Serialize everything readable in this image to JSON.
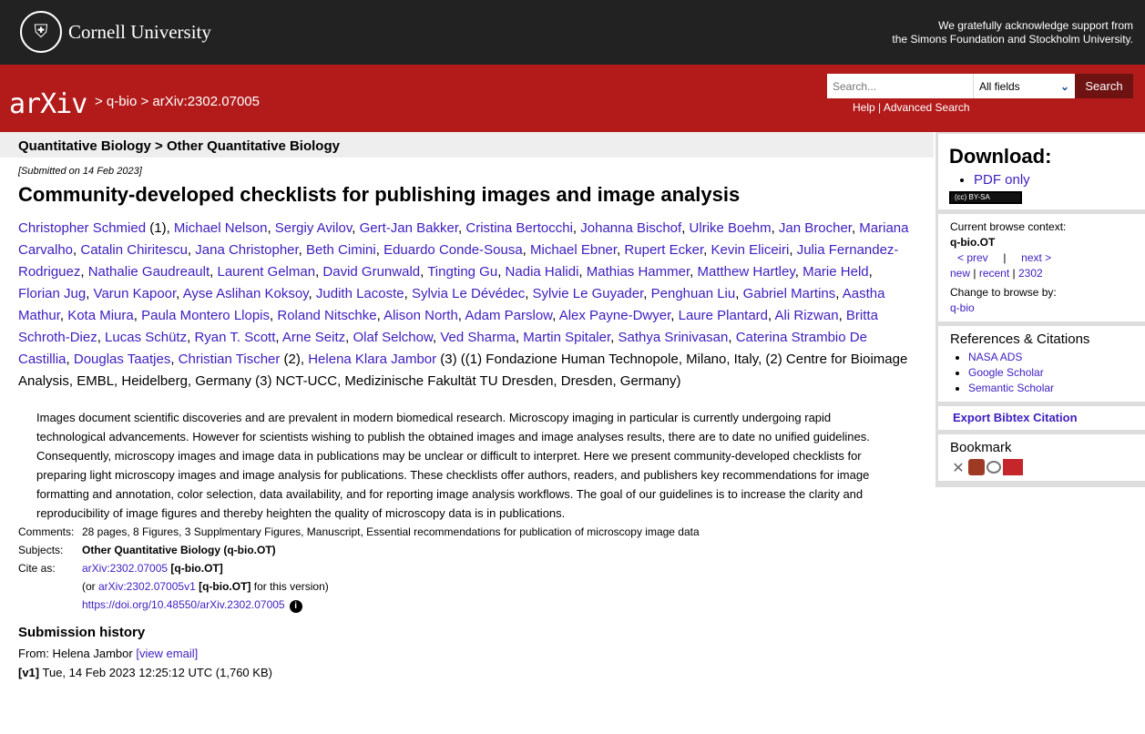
{
  "header": {
    "university": "Cornell University",
    "ack_line1": "We gratefully acknowledge support from",
    "ack_line2": "the Simons Foundation and Stockholm University."
  },
  "nav": {
    "logo": "arXiv",
    "breadcrumb": "> q-bio > arXiv:2302.07005",
    "search_placeholder": "Search...",
    "field_select": "All fields",
    "search_button": "Search",
    "help": "Help",
    "sep": "|",
    "advanced": "Advanced Search"
  },
  "paper": {
    "category": "Quantitative Biology > Other Quantitative Biology",
    "submitted": "[Submitted on 14 Feb 2023]",
    "title": "Community-developed checklists for publishing images and image analysis",
    "authors": [
      {
        "name": "Christopher Schmied",
        "after": " (1), "
      },
      {
        "name": "Michael Nelson",
        "after": ", "
      },
      {
        "name": "Sergiy Avilov",
        "after": ", "
      },
      {
        "name": "Gert-Jan Bakker",
        "after": ", "
      },
      {
        "name": "Cristina Bertocchi",
        "after": ", "
      },
      {
        "name": "Johanna Bischof",
        "after": ", "
      },
      {
        "name": "Ulrike Boehm",
        "after": ", "
      },
      {
        "name": "Jan Brocher",
        "after": ", "
      },
      {
        "name": "Mariana Carvalho",
        "after": ", "
      },
      {
        "name": "Catalin Chiritescu",
        "after": ", "
      },
      {
        "name": "Jana Christopher",
        "after": ", "
      },
      {
        "name": "Beth Cimini",
        "after": ", "
      },
      {
        "name": "Eduardo Conde-Sousa",
        "after": ", "
      },
      {
        "name": "Michael Ebner",
        "after": ", "
      },
      {
        "name": "Rupert Ecker",
        "after": ", "
      },
      {
        "name": "Kevin Eliceiri",
        "after": ", "
      },
      {
        "name": "Julia Fernandez-Rodriguez",
        "after": ", "
      },
      {
        "name": "Nathalie Gaudreault",
        "after": ", "
      },
      {
        "name": "Laurent Gelman",
        "after": ", "
      },
      {
        "name": "David Grunwald",
        "after": ", "
      },
      {
        "name": "Tingting Gu",
        "after": ", "
      },
      {
        "name": "Nadia Halidi",
        "after": ", "
      },
      {
        "name": "Mathias Hammer",
        "after": ", "
      },
      {
        "name": "Matthew Hartley",
        "after": ", "
      },
      {
        "name": "Marie Held",
        "after": ", "
      },
      {
        "name": "Florian Jug",
        "after": ", "
      },
      {
        "name": "Varun Kapoor",
        "after": ", "
      },
      {
        "name": "Ayse Aslihan Koksoy",
        "after": ", "
      },
      {
        "name": "Judith Lacoste",
        "after": ", "
      },
      {
        "name": "Sylvia Le Dévédec",
        "after": ", "
      },
      {
        "name": "Sylvie Le Guyader",
        "after": ", "
      },
      {
        "name": "Penghuan Liu",
        "after": ", "
      },
      {
        "name": "Gabriel Martins",
        "after": ", "
      },
      {
        "name": "Aastha Mathur",
        "after": ", "
      },
      {
        "name": "Kota Miura",
        "after": ", "
      },
      {
        "name": "Paula Montero Llopis",
        "after": ", "
      },
      {
        "name": "Roland Nitschke",
        "after": ", "
      },
      {
        "name": "Alison North",
        "after": ", "
      },
      {
        "name": "Adam Parslow",
        "after": ", "
      },
      {
        "name": "Alex Payne-Dwyer",
        "after": ", "
      },
      {
        "name": "Laure Plantard",
        "after": ", "
      },
      {
        "name": "Ali Rizwan",
        "after": ", "
      },
      {
        "name": "Britta Schroth-Diez",
        "after": ", "
      },
      {
        "name": "Lucas Schütz",
        "after": ", "
      },
      {
        "name": "Ryan T. Scott",
        "after": ", "
      },
      {
        "name": "Arne Seitz",
        "after": ", "
      },
      {
        "name": "Olaf Selchow",
        "after": ", "
      },
      {
        "name": "Ved Sharma",
        "after": ", "
      },
      {
        "name": "Martin Spitaler",
        "after": ", "
      },
      {
        "name": "Sathya Srinivasan",
        "after": ", "
      },
      {
        "name": "Caterina Strambio De Castillia",
        "after": ", "
      },
      {
        "name": "Douglas Taatjes",
        "after": ", "
      },
      {
        "name": "Christian Tischer",
        "after": " (2), "
      },
      {
        "name": "Helena Klara Jambor",
        "after": " (3) ((1) Fondazione Human Technopole, Milano, Italy, (2) Centre for Bioimage Analysis, EMBL, Heidelberg, Germany (3) NCT-UCC, Medizinische Fakultät TU Dresden, Dresden, Germany)"
      }
    ],
    "abstract": "Images document scientific discoveries and are prevalent in modern biomedical research. Microscopy imaging in particular is currently undergoing rapid technological advancements. However for scientists wishing to publish the obtained images and image analyses results, there are to date no unified guidelines. Consequently, microscopy images and image data in publications may be unclear or difficult to interpret. Here we present community-developed checklists for preparing light microscopy images and image analysis for publications. These checklists offer authors, readers, and publishers key recommendations for image formatting and annotation, color selection, data availability, and for reporting image analysis workflows. The goal of our guidelines is to increase the clarity and reproducibility of image figures and thereby heighten the quality of microscopy data is in publications.",
    "comments_label": "Comments:",
    "comments": "28 pages, 8 Figures, 3 Supplmentary Figures, Manuscript, Essential recommendations for publication of microscopy image data",
    "subjects_label": "Subjects:",
    "subjects": "Other Quantitative Biology (q-bio.OT)",
    "cite_label": "Cite as:",
    "cite_id": "arXiv:2302.07005",
    "cite_cat": " [q-bio.OT]",
    "cite_or": "(or ",
    "cite_v1": "arXiv:2302.07005v1",
    "cite_v1_cat": " [q-bio.OT]",
    "cite_v1_tail": " for this version)",
    "doi": "https://doi.org/10.48550/arXiv.2302.07005"
  },
  "history": {
    "title": "Submission history",
    "from": "From: Helena Jambor ",
    "view_email": "[view email]",
    "v1_label": "[v1]",
    "v1": " Tue, 14 Feb 2023 12:25:12 UTC (1,760 KB)"
  },
  "sidebar": {
    "download_title": "Download:",
    "pdf": "PDF only",
    "license": "(cc) BY-SA",
    "context_label": "Current browse context:",
    "context": "q-bio.OT",
    "prev": "< prev",
    "pipe": "|",
    "next": "next >",
    "new": "new",
    "recent": "recent",
    "month": "2302",
    "change_label": "Change to browse by:",
    "change": "q-bio",
    "refs_title": "References & Citations",
    "refs": [
      "NASA ADS",
      "Google Scholar",
      "Semantic Scholar"
    ],
    "export": "Export Bibtex Citation",
    "bookmark_title": "Bookmark",
    "bookmarks": [
      "bibsonomy-icon",
      "mendeley-icon",
      "reddit-icon",
      "sciencewise-icon"
    ]
  }
}
